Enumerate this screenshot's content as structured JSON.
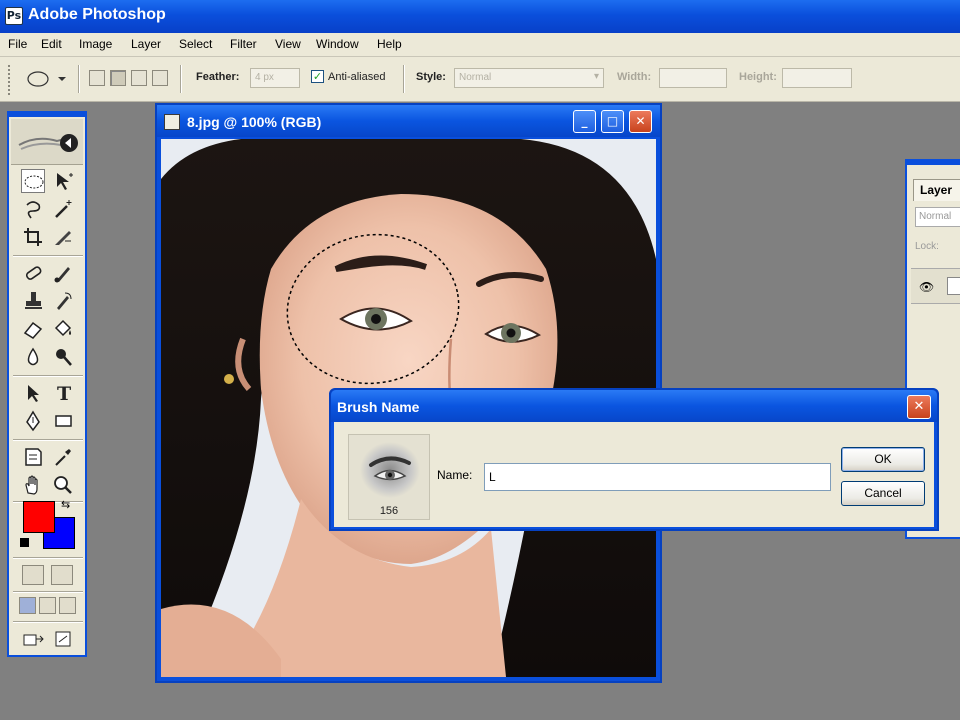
{
  "app": {
    "title": "Adobe Photoshop",
    "logo_glyph": "Ps"
  },
  "menu": [
    "File",
    "Edit",
    "Image",
    "Layer",
    "Select",
    "Filter",
    "View",
    "Window",
    "Help"
  ],
  "options_bar": {
    "feather_label": "Feather:",
    "feather_value": "4 px",
    "anti_aliased_label": "Anti-aliased",
    "anti_aliased_checked": true,
    "style_label": "Style:",
    "style_value": "Normal",
    "width_label": "Width:",
    "height_label": "Height:",
    "selection_modes": [
      "new-selection",
      "add-to-selection",
      "subtract-from-selection",
      "intersect-selection"
    ],
    "active_mode": "add-to-selection"
  },
  "tools_palette": {
    "active_tool": "elliptical-marquee",
    "foreground_color": "#ff0000",
    "background_color": "#0000ff"
  },
  "document": {
    "title": "8.jpg @ 100% (RGB)",
    "buttons": {
      "minimize": "_",
      "maximize": "□",
      "close": "✕"
    }
  },
  "layers_panel": {
    "tab": "Layer",
    "blend": "Normal",
    "lock_label": "Lock:"
  },
  "dialog": {
    "title": "Brush Name",
    "close_glyph": "✕",
    "name_label": "Name:",
    "name_value": "L",
    "brush_size": "156",
    "ok_label": "OK",
    "cancel_label": "Cancel"
  },
  "colors": {
    "xp_blue": "#0a4fdc",
    "chrome": "#ece9d8",
    "workspace": "#808080"
  }
}
